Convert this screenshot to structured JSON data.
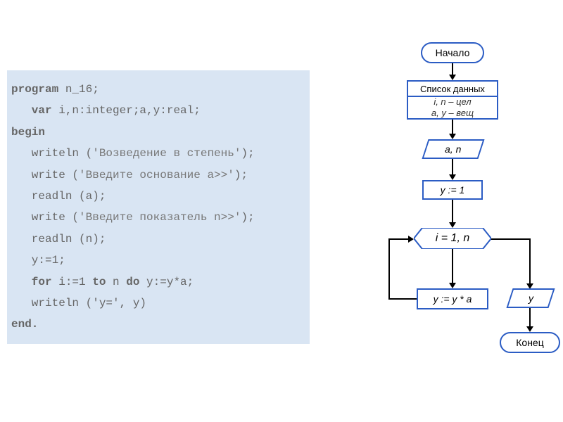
{
  "code": {
    "l1_a": "program",
    "l1_b": " n_16;",
    "l2_a": "   var",
    "l2_b": " i,n:integer;a,y:real;",
    "l3_a": "begin",
    "l4_a": "   writeln (",
    "l4_b": "'Возведение в степень'",
    "l4_c": ");",
    "l5_a": "   write (",
    "l5_b": "'Введите основание a>>'",
    "l5_c": ");",
    "l6": "   readln (a);",
    "l7_a": "   write (",
    "l7_b": "'Введите показатель n>>'",
    "l7_c": ");",
    "l8": "   readln (n);",
    "l9": "   y:=1;",
    "l10_a": "   for",
    "l10_b": " i:=1 ",
    "l10_c": "to",
    "l10_d": " n ",
    "l10_e": "do",
    "l10_f": " y:=y*a;",
    "l11": "   writeln ('y=', y)",
    "l12_a": "end."
  },
  "flow": {
    "start": "Начало",
    "list_header": "Список данных",
    "types_1": "i, n – цел",
    "types_2": "a, y – вещ",
    "input": "a, n",
    "init": "y := 1",
    "loop": "i = 1, n",
    "body": "y := y * a",
    "output": "y",
    "end": "Конец"
  },
  "chart_data": {
    "type": "table",
    "title": "Flowchart: Возведение в степень (exponentiation a^n)",
    "nodes": [
      {
        "id": "start",
        "type": "terminator",
        "label": "Начало"
      },
      {
        "id": "decl",
        "type": "annotation",
        "label": "Список данных: i, n – цел; a, y – вещ"
      },
      {
        "id": "input",
        "type": "io",
        "label": "a, n"
      },
      {
        "id": "init",
        "type": "process",
        "label": "y := 1"
      },
      {
        "id": "loop",
        "type": "loop",
        "label": "i = 1, n"
      },
      {
        "id": "body",
        "type": "process",
        "label": "y := y * a"
      },
      {
        "id": "output",
        "type": "io",
        "label": "y"
      },
      {
        "id": "end",
        "type": "terminator",
        "label": "Конец"
      }
    ],
    "edges": [
      [
        "start",
        "decl"
      ],
      [
        "decl",
        "input"
      ],
      [
        "input",
        "init"
      ],
      [
        "init",
        "loop"
      ],
      [
        "loop",
        "body"
      ],
      [
        "body",
        "loop"
      ],
      [
        "loop",
        "output"
      ],
      [
        "output",
        "end"
      ]
    ]
  }
}
